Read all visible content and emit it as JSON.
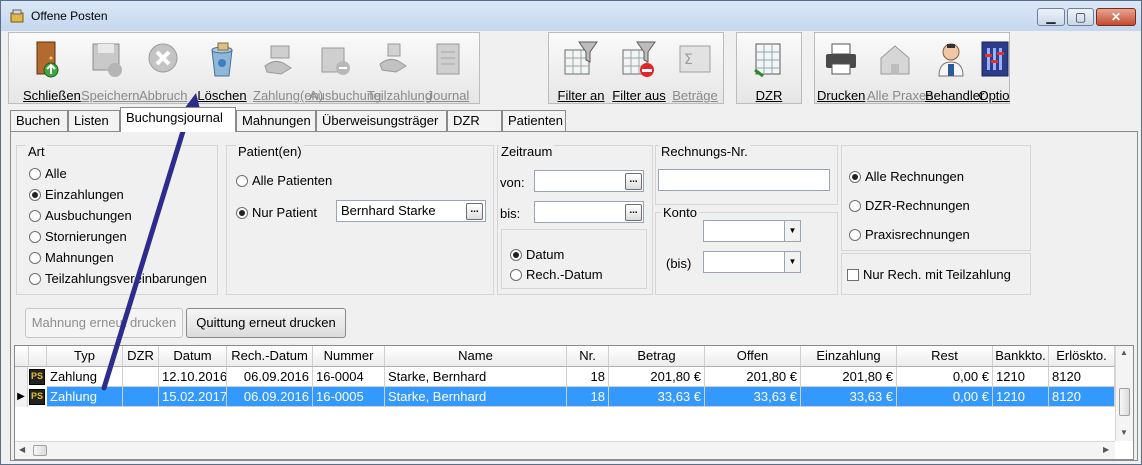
{
  "window": {
    "title": "Offene Posten",
    "min_glyph": "▁",
    "max_glyph": "▢",
    "close_glyph": "✕"
  },
  "toolbar": {
    "schliessen": "Schließen",
    "speichern": "Speichern",
    "abbruch": "Abbruch",
    "loeschen": "Löschen",
    "zahlungen": "Zahlung(en)",
    "ausbuchung": "Ausbuchung",
    "teilzahlung": "Teilzahlung",
    "journal": "Journal",
    "filter_an": "Filter an",
    "filter_aus": "Filter aus",
    "betraege": "Beträge",
    "dzr": "DZR",
    "drucken": "Drucken",
    "alle_praxen": "Alle Praxen",
    "behandler": "Behandler",
    "optio": "Optio"
  },
  "tabs": [
    "Buchen",
    "Listen",
    "Buchungsjournal",
    "Mahnungen",
    "Überweisungsträger",
    "DZR",
    "Patienten"
  ],
  "art": {
    "title": "Art",
    "options": [
      "Alle",
      "Einzahlungen",
      "Ausbuchungen",
      "Stornierungen",
      "Mahnungen",
      "Teilzahlungsvereinbarungen"
    ],
    "selected_index": 1
  },
  "patient": {
    "title": "Patient(en)",
    "alle_label": "Alle Patienten",
    "nur_label": "Nur Patient",
    "name_value": "Bernhard Starke",
    "dots": "..."
  },
  "zeitraum": {
    "title": "Zeitraum",
    "von_label": "von:",
    "bis_label": "bis:",
    "von_value": "",
    "bis_value": "",
    "datum_label": "Datum",
    "rechdatum_label": "Rech.-Datum"
  },
  "rechnungsnr": {
    "title": "Rechnungs-Nr.",
    "value": ""
  },
  "konto": {
    "title": "Konto",
    "bis_label": "(bis)",
    "value_from": "",
    "value_to": "",
    "arrow": "▼"
  },
  "rechnungsart": {
    "alle": "Alle Rechnungen",
    "dzr": "DZR-Rechnungen",
    "praxis": "Praxisrechnungen",
    "teilzahlung": "Nur Rech. mit Teilzahlung"
  },
  "buttons": {
    "mahnung_erneut": "Mahnung erneut drucken",
    "quittung_erneut": "Quittung erneut drucken"
  },
  "table": {
    "headers": [
      "Typ",
      "DZR",
      "Datum",
      "Rech.-Datum",
      "Nummer",
      "Name",
      "Nr.",
      "Betrag",
      "Offen",
      "Einzahlung",
      "Rest",
      "Bankkto.",
      "Erlöskto."
    ],
    "rows": [
      {
        "typ": "Zahlung",
        "dzr": "",
        "datum": "12.10.2016",
        "rechdatum": "06.09.2016",
        "nummer": "16-0004",
        "name": "Starke, Bernhard",
        "nr": "18",
        "betrag": "201,80 €",
        "offen": "201,80 €",
        "einzahlung": "201,80 €",
        "rest": "0,00 €",
        "bankkto": "1210",
        "erloeskto": "8120"
      },
      {
        "typ": "Zahlung",
        "dzr": "",
        "datum": "15.02.2017",
        "rechdatum": "06.09.2016",
        "nummer": "16-0005",
        "name": "Starke, Bernhard",
        "nr": "18",
        "betrag": "33,63 €",
        "offen": "33,63 €",
        "einzahlung": "33,63 €",
        "rest": "0,00 €",
        "bankkto": "1210",
        "erloeskto": "8120"
      }
    ],
    "row_icon_text": "PS",
    "current_row_marker": "▶"
  },
  "colors": {
    "selection": "#3399ff",
    "annotation_arrow": "#2e2b8f"
  }
}
